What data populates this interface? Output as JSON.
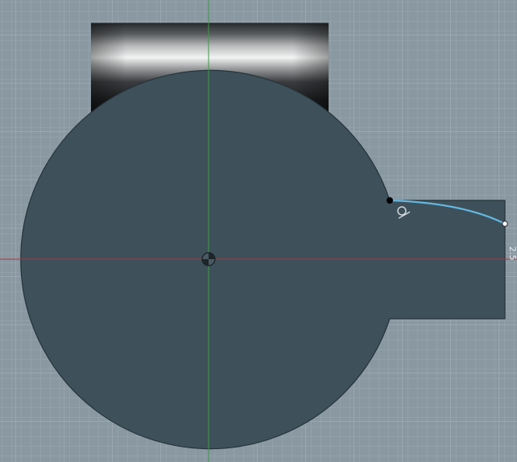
{
  "viewport": {
    "background_color": "#8a98a2",
    "grid_minor_color": "#9aa8b2",
    "grid_major_color": "#a9b6bf",
    "x_axis_color": "#b5333a",
    "y_axis_color": "#3f9a48",
    "profile_fill_color": "#3e505a",
    "profile_edge_color": "#26343b",
    "sketch_curve_color": "#63b8e2"
  },
  "sketch": {
    "constraint_icon": "tangent-constraint-icon",
    "dimension_label": "2.5",
    "origin_icon": "origin-marker-icon"
  }
}
